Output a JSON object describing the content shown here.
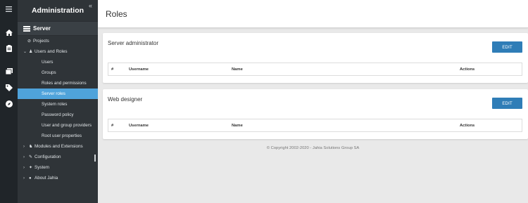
{
  "rail": {
    "icons": [
      "hamburger-icon",
      "home-icon",
      "clipboard-icon",
      "gallery-icon",
      "tag-icon",
      "compass-icon"
    ]
  },
  "sidebar": {
    "title": "Administration",
    "collapse_glyph": "«",
    "server_label": "Server",
    "items": [
      {
        "label": "Projects",
        "chevron": "",
        "glyph": "⊘"
      },
      {
        "label": "Users and Roles",
        "chevron": "⌄",
        "glyph": "♟"
      },
      {
        "label": "Users"
      },
      {
        "label": "Groups"
      },
      {
        "label": "Roles and permissions"
      },
      {
        "label": "Server roles",
        "active": true
      },
      {
        "label": "System roles"
      },
      {
        "label": "Password policy"
      },
      {
        "label": "User and group providers"
      },
      {
        "label": "Root user properties"
      },
      {
        "label": "Modules and Extensions",
        "chevron": "›",
        "glyph": "♞"
      },
      {
        "label": "Configuration",
        "chevron": "›",
        "glyph": "✎"
      },
      {
        "label": "System",
        "chevron": "›",
        "glyph": "✦"
      },
      {
        "label": "About Jahia",
        "chevron": "›",
        "glyph": "●"
      }
    ]
  },
  "header": {
    "title": "Roles"
  },
  "cards": [
    {
      "title": "Server administrator",
      "edit_label": "EDIT",
      "columns": [
        "#",
        "Username",
        "Name",
        "Actions"
      ]
    },
    {
      "title": "Web designer",
      "edit_label": "EDIT",
      "columns": [
        "#",
        "Username",
        "Name",
        "Actions"
      ]
    }
  ],
  "footer": {
    "copyright": "© Copyright 2002-2020 - Jahia Solutions Group SA"
  },
  "colors": {
    "accent": "#2f7db7",
    "active_nav": "#4fa3db",
    "sidebar_bg": "#2f3438",
    "rail_bg": "#202529"
  }
}
